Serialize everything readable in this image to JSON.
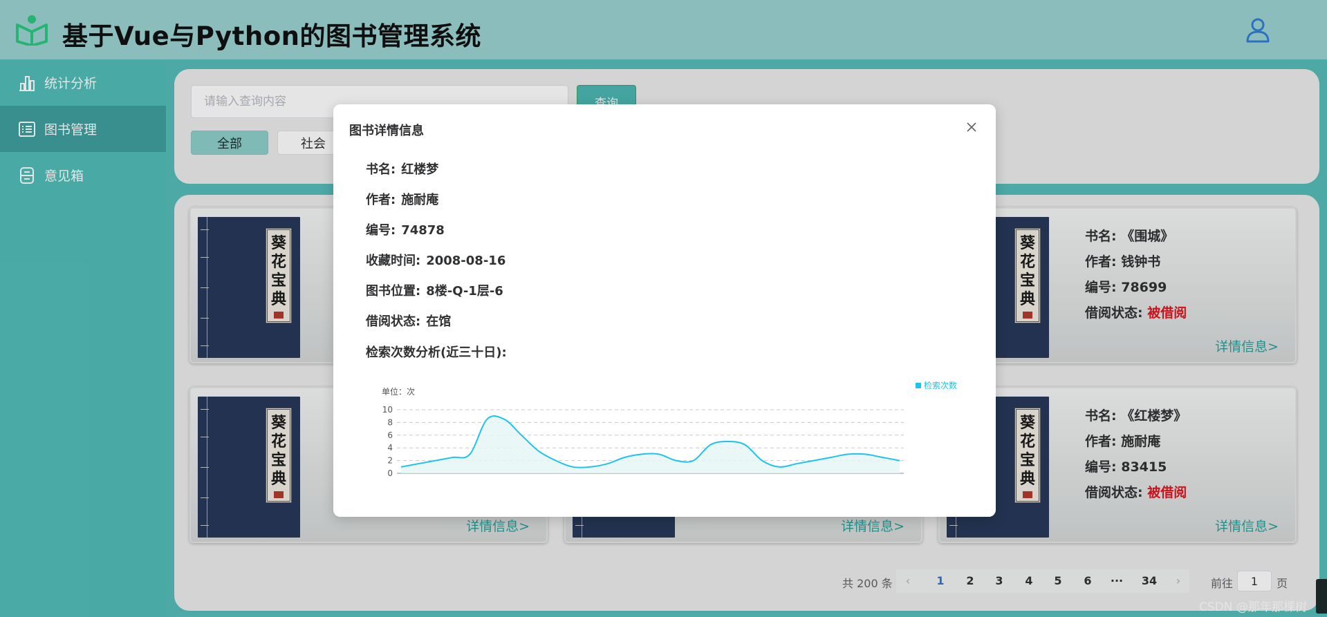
{
  "header": {
    "title": "基于Vue与Python的图书管理系统",
    "logo_icon": "book-reader-icon",
    "user_icon": "user-icon"
  },
  "sidebar": {
    "items": [
      {
        "label": "统计分析",
        "icon": "bar-chart-icon",
        "active": false
      },
      {
        "label": "图书管理",
        "icon": "list-icon",
        "active": true
      },
      {
        "label": "意见箱",
        "icon": "inbox-icon",
        "active": false
      }
    ]
  },
  "search": {
    "placeholder": "请输入查询内容",
    "button": "查询"
  },
  "categories": [
    "全部",
    "社会"
  ],
  "books": [
    {
      "name": "",
      "author": "",
      "id": "",
      "status": "",
      "link": ""
    },
    {
      "name": "",
      "author": "",
      "id": "",
      "status": "",
      "link": ""
    },
    {
      "name_label": "书名: ",
      "name": "《围城》",
      "author_label": "作者: ",
      "author": "钱钟书",
      "id_label": "编号: ",
      "id": "78699",
      "status_label": "借阅状态: ",
      "status": "被借阅",
      "link": "详情信息>"
    },
    {
      "link": "详情信息>"
    },
    {
      "link": "详情信息>"
    },
    {
      "name_label": "书名: ",
      "name": "《红楼梦》",
      "author_label": "作者: ",
      "author": "施耐庵",
      "id_label": "编号: ",
      "id": "83415",
      "status_label": "借阅状态: ",
      "status": "被借阅",
      "link": "详情信息>"
    }
  ],
  "cover": {
    "chars": [
      "葵",
      "花",
      "宝",
      "典"
    ]
  },
  "pagination": {
    "total": "共 200 条",
    "pages": [
      "1",
      "2",
      "3",
      "4",
      "5",
      "6",
      "···",
      "34"
    ],
    "current": "1",
    "goto_prefix": "前往",
    "goto_value": "1",
    "goto_suffix": "页"
  },
  "watermark": "CSDN @那年那棵树",
  "dialog": {
    "title": "图书详情信息",
    "fields": [
      {
        "label": "书名:",
        "value": "红楼梦"
      },
      {
        "label": "作者:",
        "value": "施耐庵"
      },
      {
        "label": "编号:",
        "value": "74878"
      },
      {
        "label": "收藏时间:",
        "value": "2008-08-16"
      },
      {
        "label": "图书位置:",
        "value": "8楼-Q-1层-6"
      },
      {
        "label": "借阅状态:",
        "value": "在馆"
      }
    ],
    "chart_heading": "检索次数分析(近三十日):"
  },
  "chart_data": {
    "type": "area",
    "title": "",
    "unit_label": "单位：次",
    "legend": [
      "检索次数"
    ],
    "legend_position": "top-right",
    "series": [
      {
        "name": "检索次数",
        "color": "#1ec3e8",
        "values": [
          1,
          1.5,
          2,
          2.5,
          3,
          8.5,
          8.5,
          6,
          3.5,
          2,
          1,
          1,
          1.5,
          2.5,
          3,
          3,
          2,
          2,
          4.5,
          5,
          4.5,
          2,
          1,
          1.5,
          2,
          2.5,
          3,
          3,
          2.5,
          2
        ]
      }
    ],
    "ylim": [
      0,
      10
    ],
    "yticks": [
      0,
      2,
      4,
      6,
      8,
      10
    ],
    "grid": true,
    "colors": {
      "accent": "#1ec3e8",
      "fill": "#e3f6f5",
      "borrowed": "#e5151f",
      "theme": "#52bdb8"
    }
  }
}
